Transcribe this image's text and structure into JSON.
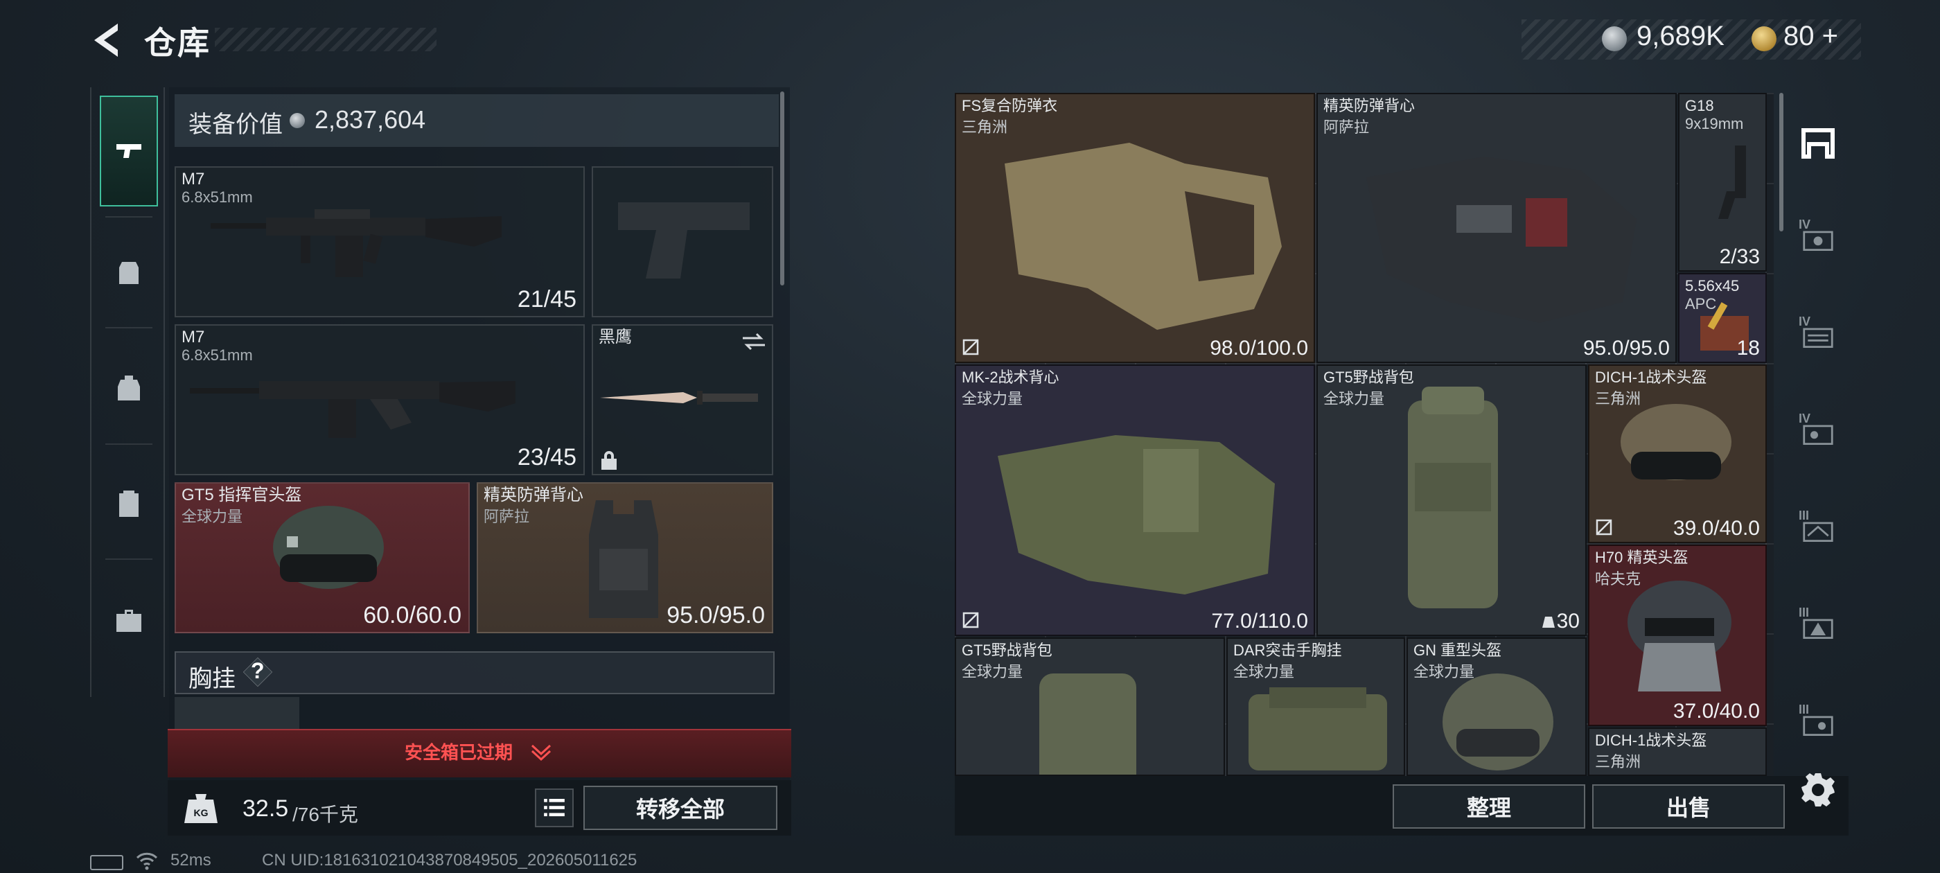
{
  "header": {
    "title": "仓库",
    "back_icon": "back-arrow-icon"
  },
  "currency": {
    "money": "9,689K",
    "tokens": "80 +"
  },
  "left_rail": {
    "items": [
      {
        "name": "pistol-icon",
        "active": true
      },
      {
        "name": "loadout-icon",
        "active": false
      },
      {
        "name": "backpack-icon",
        "active": false
      },
      {
        "name": "locker-icon",
        "active": false
      },
      {
        "name": "briefcase-icon",
        "active": false
      }
    ]
  },
  "equipment": {
    "value_label": "装备价值",
    "value": "2,837,604",
    "slots": [
      {
        "name": "M7",
        "sub": "6.8x51mm",
        "count": "21/45"
      },
      {
        "name": "",
        "sub": "",
        "count": ""
      },
      {
        "name": "M7",
        "sub": "6.8x51mm",
        "count": "23/45"
      },
      {
        "name": "黑鹰",
        "sub": "",
        "count": ""
      },
      {
        "name": "GT5 指挥官头盔",
        "sub": "全球力量",
        "count": "60.0/60.0"
      },
      {
        "name": "精英防弹背心",
        "sub": "阿萨拉",
        "count": "95.0/95.0"
      }
    ],
    "chest_label": "胸挂",
    "chest_help": "?"
  },
  "safe_banner": "安全箱已过期",
  "weight": {
    "current": "32.5",
    "max": "/76千克",
    "icon_label": "KG"
  },
  "buttons": {
    "transfer_all": "转移全部",
    "sort": "整理",
    "sell": "出售"
  },
  "status": {
    "ping": "52ms",
    "uid": "CN UID:181631021043870849505_202605011625"
  },
  "stash": {
    "items": [
      {
        "name": "FS复合防弹衣",
        "sub": "三角洲",
        "val": "98.0/100.0"
      },
      {
        "name": "精英防弹背心",
        "sub": "阿萨拉",
        "val": "95.0/95.0"
      },
      {
        "name": "G18",
        "sub": "9x19mm",
        "val": "2/33"
      },
      {
        "name": "5.56x45",
        "sub": "APC",
        "val": "18"
      },
      {
        "name": "MK-2战术背心",
        "sub": "全球力量",
        "val": "77.0/110.0"
      },
      {
        "name": "GT5野战背包",
        "sub": "全球力量",
        "val": "30"
      },
      {
        "name": "DICH-1战术头盔",
        "sub": "三角洲",
        "val": "39.0/40.0"
      },
      {
        "name": "H70 精英头盔",
        "sub": "哈夫克",
        "val": "37.0/40.0"
      },
      {
        "name": "GT5野战背包",
        "sub": "全球力量",
        "val": ""
      },
      {
        "name": "DAR突击手胸挂",
        "sub": "全球力量",
        "val": ""
      },
      {
        "name": "GN 重型头盔",
        "sub": "全球力量",
        "val": ""
      },
      {
        "name": "DICH-1战术头盔",
        "sub": "三角洲",
        "val": ""
      }
    ]
  },
  "right_rail": {
    "items": [
      {
        "name": "stash-main-icon",
        "level": ""
      },
      {
        "name": "stash-iv-a-icon",
        "level": "IV"
      },
      {
        "name": "stash-iv-b-icon",
        "level": "IV"
      },
      {
        "name": "stash-iv-c-icon",
        "level": "IV"
      },
      {
        "name": "stash-iii-a-icon",
        "level": "III"
      },
      {
        "name": "stash-iii-b-icon",
        "level": "III"
      },
      {
        "name": "stash-iii-c-icon",
        "level": "III"
      }
    ]
  },
  "colors": {
    "accent_green": "#3fbf9c",
    "warning_red": "#ff5252"
  }
}
